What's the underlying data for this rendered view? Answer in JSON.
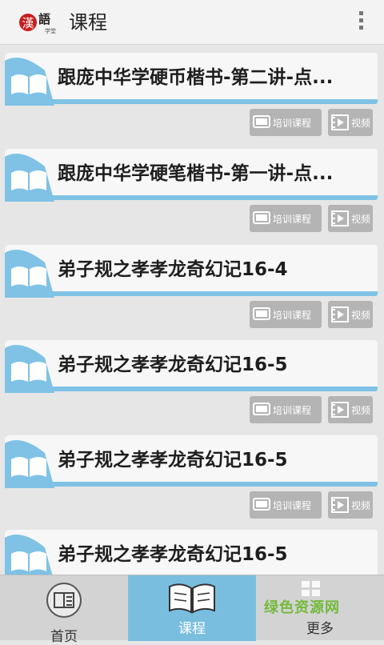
{
  "header": {
    "title": "课程"
  },
  "items": [
    {
      "title": "跟庞中华学硬币楷书-第二讲-点..."
    },
    {
      "title": "跟庞中华学硬笔楷书-第一讲-点..."
    },
    {
      "title": "弟子规之孝孝龙奇幻记16-4"
    },
    {
      "title": "弟子规之孝孝龙奇幻记16-5"
    },
    {
      "title": "弟子规之孝孝龙奇幻记16-5"
    },
    {
      "title": "弟子规之孝孝龙奇幻记16-5"
    }
  ],
  "item_buttons": {
    "training_label": "培训课程",
    "video_label": "视频"
  },
  "tabs": {
    "home": "首页",
    "course": "课程",
    "more": "更多"
  },
  "watermark": "绿色资源网",
  "colors": {
    "accent": "#79bedf",
    "stripe": "#7fc2e6",
    "button": "#b4b4b4"
  }
}
